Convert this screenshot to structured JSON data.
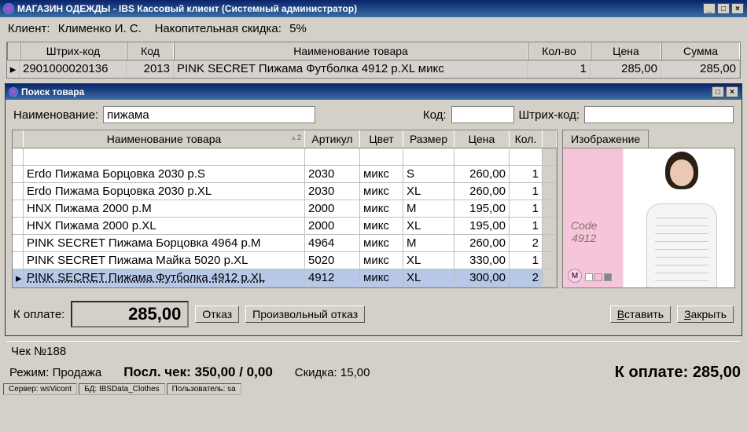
{
  "window": {
    "title": "МАГАЗИН ОДЕЖДЫ - IBS Кассовый клиент (Системный администратор)"
  },
  "client": {
    "label": "Клиент:",
    "name": "Клименко И. С.",
    "discount_label": "Накопительная скидка:",
    "discount_value": "5%"
  },
  "main_table": {
    "headers": {
      "barcode": "Штрих-код",
      "code": "Код",
      "name": "Наименование товара",
      "qty": "Кол-во",
      "price": "Цена",
      "sum": "Сумма"
    },
    "row": {
      "barcode": "2901000020136",
      "code": "2013",
      "name": "PINK SECRET Пижама Футболка 4912 р.XL микс",
      "qty": "1",
      "price": "285,00",
      "sum": "285,00"
    }
  },
  "search": {
    "title": "Поиск товара",
    "name_label": "Наименование:",
    "name_value": "пижама",
    "code_label": "Код:",
    "code_value": "",
    "barcode_label": "Штрих-код:",
    "barcode_value": "",
    "headers": {
      "name": "Наименование товара",
      "art": "Артикул",
      "color": "Цвет",
      "size": "Размер",
      "price": "Цена",
      "qty": "Кол."
    },
    "rows": [
      {
        "name": "Erdo Пижама Борцовка 2030 р.S",
        "art": "2030",
        "color": "микс",
        "size": "S",
        "price": "260,00",
        "qty": "1",
        "sel": false
      },
      {
        "name": "Erdo Пижама Борцовка 2030 р.XL",
        "art": "2030",
        "color": "микс",
        "size": "XL",
        "price": "260,00",
        "qty": "1",
        "sel": false
      },
      {
        "name": "HNX Пижама 2000 р.M",
        "art": "2000",
        "color": "микс",
        "size": "M",
        "price": "195,00",
        "qty": "1",
        "sel": false
      },
      {
        "name": "HNX Пижама 2000 р.XL",
        "art": "2000",
        "color": "микс",
        "size": "XL",
        "price": "195,00",
        "qty": "1",
        "sel": false
      },
      {
        "name": "PINK SECRET Пижама Борцовка 4964 р.M",
        "art": "4964",
        "color": "микс",
        "size": "M",
        "price": "260,00",
        "qty": "2",
        "sel": false
      },
      {
        "name": "PINK SECRET Пижама Майка 5020 р.XL",
        "art": "5020",
        "color": "микс",
        "size": "XL",
        "price": "330,00",
        "qty": "1",
        "sel": false
      },
      {
        "name": "PINK SECRET Пижама Футболка 4912 р.XL",
        "art": "4912",
        "color": "микс",
        "size": "XL",
        "price": "300,00",
        "qty": "2",
        "sel": true
      }
    ],
    "image_tab": "Изображение",
    "image_code_label": "Code",
    "image_code_value": "4912",
    "image_badge": "M",
    "to_pay_label": "К оплате:",
    "to_pay_value": "285,00",
    "btn_refuse": "Отказ",
    "btn_arb_refuse": "Произвольный отказ",
    "btn_insert": "Вставить",
    "btn_close": "Закрыть"
  },
  "receipt": {
    "label": "Чек №188"
  },
  "status": {
    "mode_label": "Режим:",
    "mode_value": "Продажа",
    "last_check_label": "Посл. чек:",
    "last_check_value": "350,00 / 0,00",
    "discount_label": "Скидка:",
    "discount_value": "15,00",
    "topay_label": "К оплате:",
    "topay_value": "285,00",
    "server": "Сервер: wsVicont",
    "db": "БД: IBSData_Clothes",
    "user": "Пользователь: sa"
  }
}
